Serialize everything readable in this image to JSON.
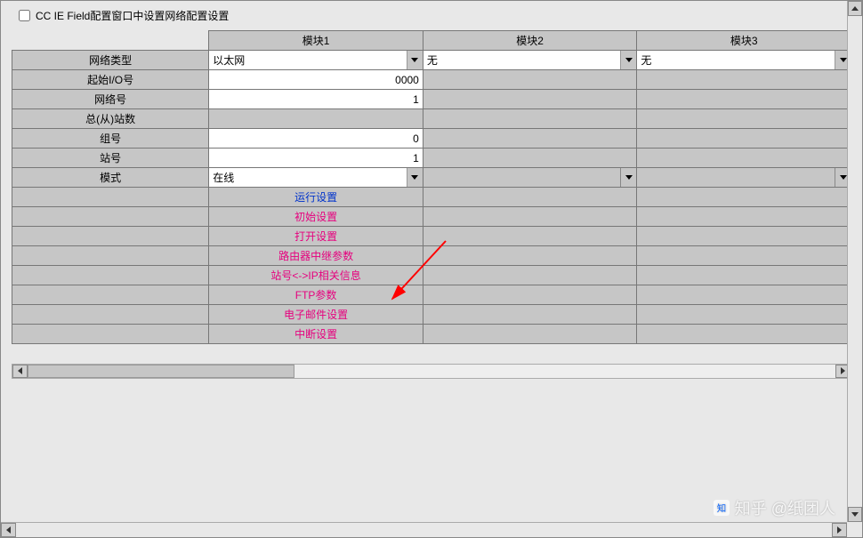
{
  "checkbox_label": "CC IE Field配置窗口中设置网络配置设置",
  "headers": {
    "m1": "模块1",
    "m2": "模块2",
    "m3": "模块3"
  },
  "rows": {
    "network_type_label": "网络类型",
    "network_type_m1": "以太网",
    "network_type_m2": "无",
    "network_type_m3": "无",
    "start_io_label": "起始I/O号",
    "start_io_value": "0000",
    "network_no_label": "网络号",
    "network_no_value": "1",
    "total_stations_label": "总(从)站数",
    "group_no_label": "组号",
    "group_no_value": "0",
    "station_no_label": "站号",
    "station_no_value": "1",
    "mode_label": "模式",
    "mode_m1": "在线"
  },
  "links": {
    "run_settings": "运行设置",
    "initial_settings": "初始设置",
    "open_settings": "打开设置",
    "router_relay_params": "路由器中继参数",
    "station_ip_info": "站号<->IP相关信息",
    "ftp_params": "FTP参数",
    "email_settings": "电子邮件设置",
    "interrupt_settings": "中断设置"
  },
  "watermark": "知乎 @纸团人"
}
